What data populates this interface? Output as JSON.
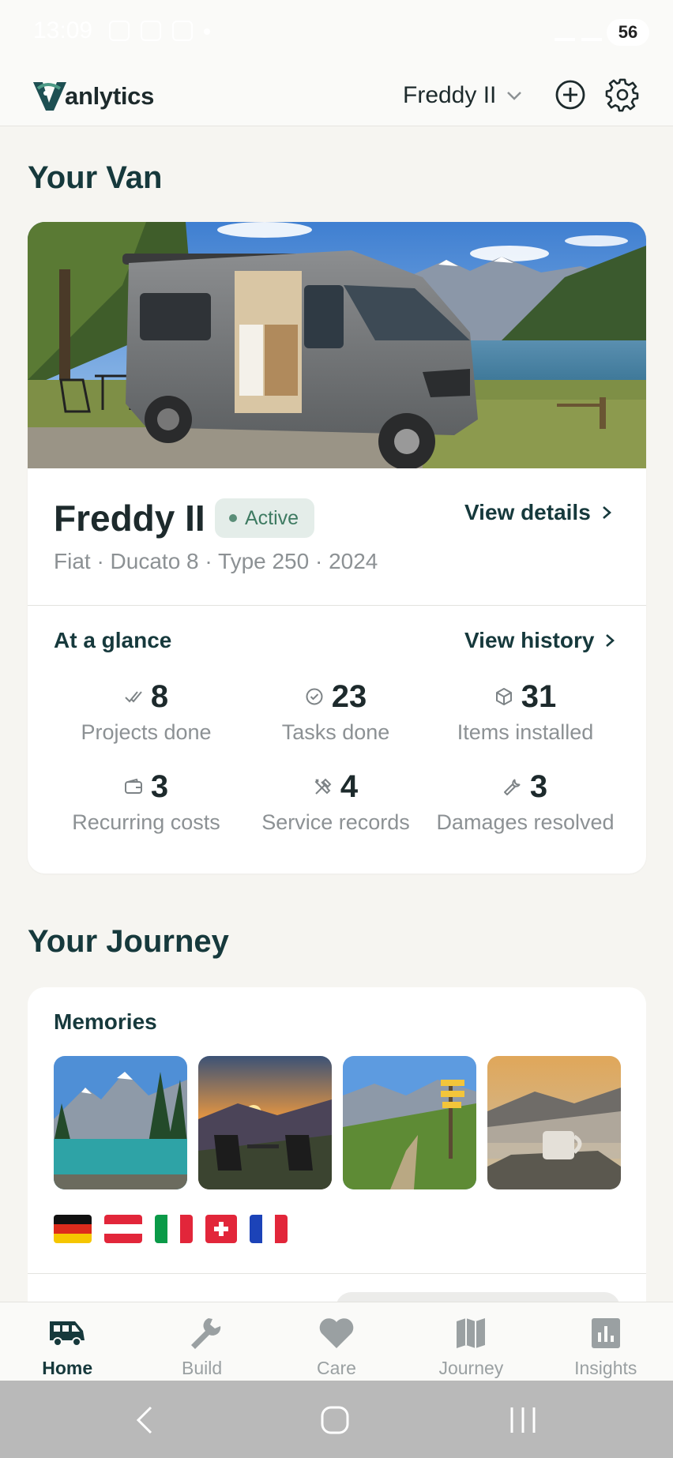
{
  "status_bar": {
    "time": "13:09",
    "battery": "56"
  },
  "header": {
    "brand": "anlytics",
    "van_selector": "Freddy II"
  },
  "your_van": {
    "section_title": "Your Van",
    "name": "Freddy II",
    "status": "Active",
    "view_details": "View details",
    "meta": "Fiat · Ducato 8 · Type 250 · 2024",
    "glance_title": "At a glance",
    "view_history": "View history",
    "stats": [
      {
        "icon": "check-double-icon",
        "value": "8",
        "label": "Projects done"
      },
      {
        "icon": "check-circle-icon",
        "value": "23",
        "label": "Tasks done"
      },
      {
        "icon": "box-icon",
        "value": "31",
        "label": "Items installed"
      },
      {
        "icon": "wallet-icon",
        "value": "3",
        "label": "Recurring costs"
      },
      {
        "icon": "tools-icon",
        "value": "4",
        "label": "Service records"
      },
      {
        "icon": "wrench-icon",
        "value": "3",
        "label": "Damages resolved"
      }
    ]
  },
  "your_journey": {
    "section_title": "Your Journey",
    "memories_title": "Memories",
    "memories": [
      "mountain-lake",
      "sunset-chairs",
      "trail-signpost",
      "misty-mug"
    ],
    "flags": [
      "Germany",
      "Austria",
      "Italy",
      "Switzerland",
      "France"
    ]
  },
  "bottom_nav": [
    {
      "icon": "van-icon",
      "label": "Home",
      "active": true
    },
    {
      "icon": "wrench-icon",
      "label": "Build",
      "active": false
    },
    {
      "icon": "heart-icon",
      "label": "Care",
      "active": false
    },
    {
      "icon": "map-icon",
      "label": "Journey",
      "active": false
    },
    {
      "icon": "bar-chart-icon",
      "label": "Insights",
      "active": false
    }
  ],
  "colors": {
    "primary": "#16393c",
    "active_badge_bg": "#e4ede9",
    "active_badge_text": "#3e7b62",
    "muted_text": "#8c9194",
    "background": "#f6f5f1"
  }
}
